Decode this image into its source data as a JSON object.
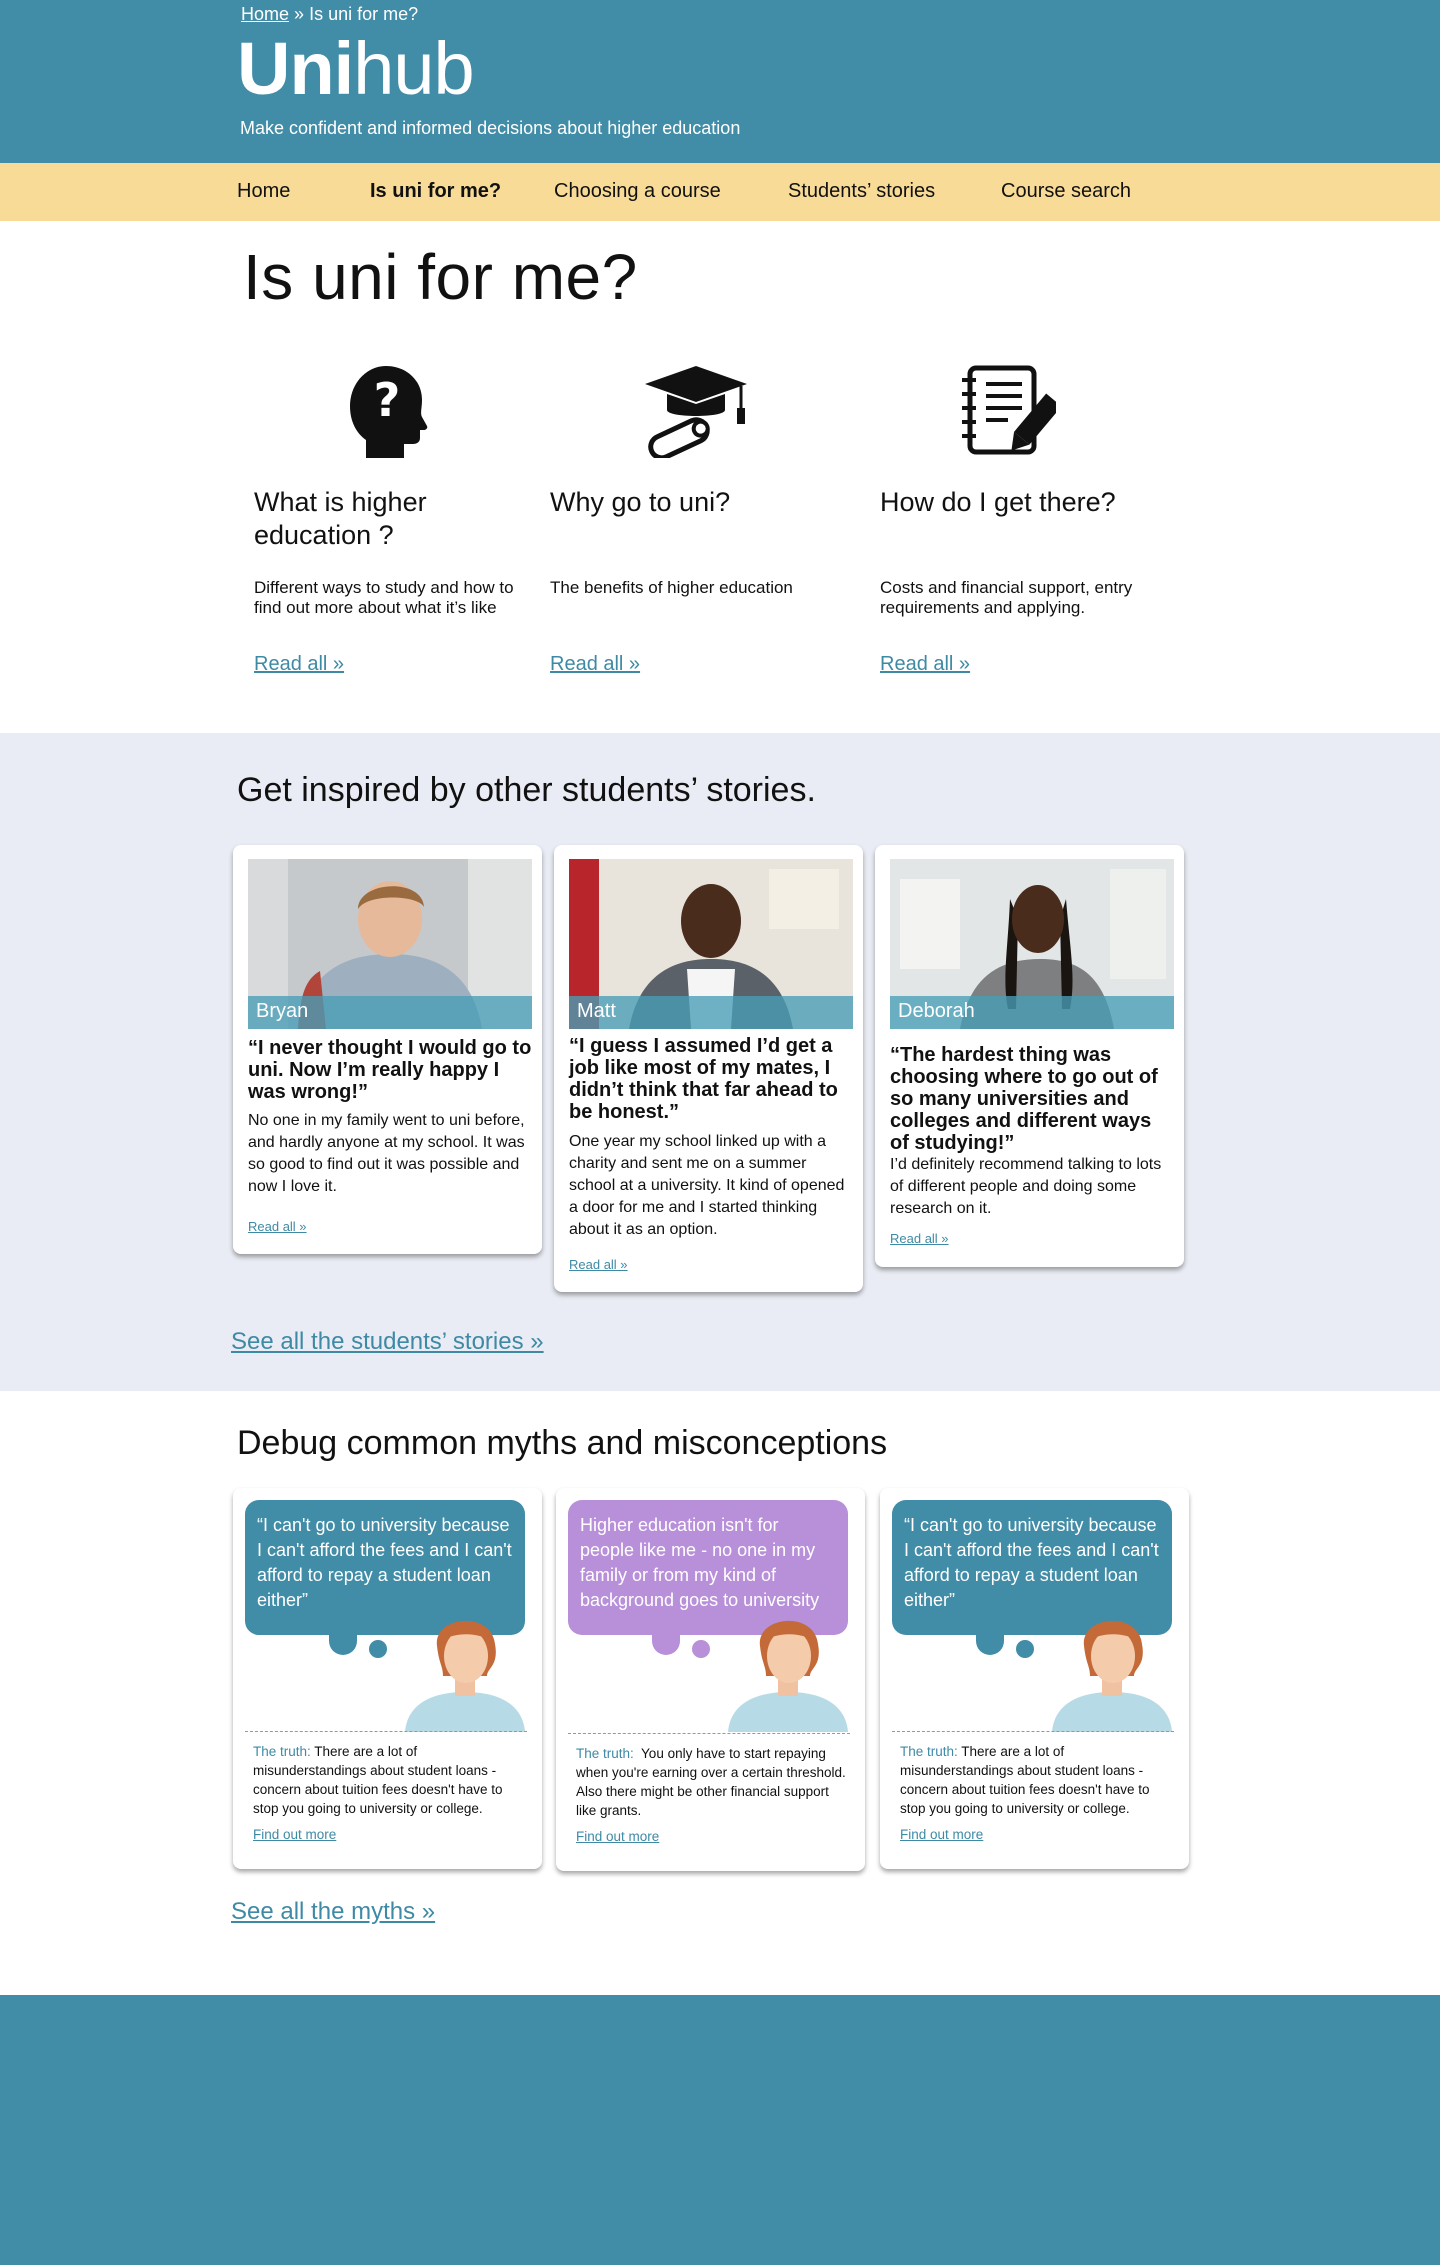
{
  "header": {
    "breadcrumb": {
      "home": "Home",
      "separator": "»",
      "current": "Is uni for me?"
    },
    "logo": {
      "bold": "Uni",
      "light": "hub"
    },
    "tagline": "Make confident and informed decisions about higher education",
    "color": "#418ca6"
  },
  "nav": {
    "color": "#f8db97",
    "items": [
      {
        "label": "Home"
      },
      {
        "label": "Is uni for me?",
        "active": true
      },
      {
        "label": "Choosing a course"
      },
      {
        "label": "Students’ stories"
      },
      {
        "label": "Course search"
      }
    ]
  },
  "page": {
    "title": "Is uni for me?"
  },
  "topics": [
    {
      "icon": "head-question-icon",
      "title": "What is higher education ?",
      "description": "Different ways to study and how to find out more about what it’s like",
      "link": "Read all »"
    },
    {
      "icon": "graduation-cap-icon",
      "title": "Why go to uni?",
      "description": "The benefits of higher education",
      "link": "Read all »"
    },
    {
      "icon": "notebook-pencil-icon",
      "title": "How do I get there?",
      "description": "Costs and financial support, entry requirements and applying.",
      "link": "Read all »"
    }
  ],
  "stories": {
    "title": "Get inspired by other students’ stories.",
    "background": "#e9ecf4",
    "cards": [
      {
        "name": "Bryan",
        "quote": "“I never thought I would go to uni. Now I’m really happy I was wrong!”",
        "body": "No one in my family went to uni before, and hardly anyone at my school. It was so good to find out it was possible and now I love it.",
        "link": "Read all »"
      },
      {
        "name": "Matt",
        "quote": "“I guess I assumed I’d get a job like most of my mates, I didn’t think that far ahead to be honest.”",
        "body": "One year my school linked up with a charity and sent me on a summer school at a university. It kind of opened a door for me and I started thinking about it as an option.",
        "link": "Read all »"
      },
      {
        "name": "Deborah",
        "quote": "“The hardest thing was choosing where to go out of so many universities and colleges and different ways of studying!”",
        "body": "I’d definitely recommend talking to lots of different people and doing some research on it.",
        "link": "Read all »"
      }
    ],
    "see_all": "See all the students’ stories »"
  },
  "myths": {
    "title": "Debug common myths and misconceptions",
    "cards": [
      {
        "myth": "“I can't go to university because I can't afford the fees and I can't afford to repay a student loan either”",
        "color": "#418ca6",
        "truth_label": "The truth:",
        "truth": "There are a lot of misunderstandings about student loans - concern about tuition fees doesn't have to stop you going to university or college.",
        "link": "Find out more"
      },
      {
        "myth": "Higher education isn't for people like me - no one in my family or from my kind of background goes to university",
        "color": "#b88fd9",
        "truth_label": "The truth:",
        "truth": "You only have to start repaying when you're earning over a certain threshold. Also there might be other financial support like grants.",
        "link": "Find out more"
      },
      {
        "myth": "“I can't go to university because I can't afford the fees and I can't afford to repay a student loan either”",
        "color": "#418ca6",
        "truth_label": "The truth:",
        "truth": "There are a lot of misunderstandings about student loans - concern about tuition fees doesn't have to stop you going to university or college.",
        "link": "Find out more"
      }
    ],
    "see_all": "See all the myths »"
  },
  "footer": {
    "color": "#418ca6"
  }
}
